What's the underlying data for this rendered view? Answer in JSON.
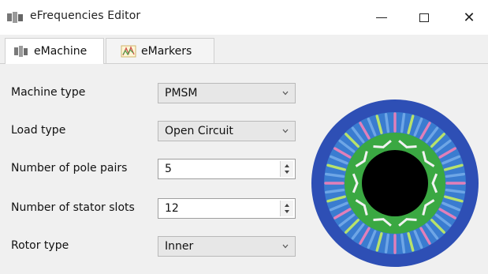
{
  "window": {
    "title": "eFrequencies Editor",
    "minimize_icon": "minimize-icon",
    "maximize_icon": "maximize-icon",
    "close_glyph": "✕"
  },
  "tabs": [
    {
      "label": "eMachine",
      "active": true,
      "icon": "machine-icon"
    },
    {
      "label": "eMarkers",
      "active": false,
      "icon": "markers-icon"
    }
  ],
  "form": {
    "machine_type": {
      "label": "Machine type",
      "value": "PMSM"
    },
    "load_type": {
      "label": "Load type",
      "value": "Open Circuit"
    },
    "pole_pairs": {
      "label": "Number of pole pairs",
      "value": "5"
    },
    "stator_slots": {
      "label": "Number of stator slots",
      "value": "12"
    },
    "rotor_type": {
      "label": "Rotor type",
      "value": "Inner"
    }
  },
  "colors": {
    "stator_outer": "#2e4fb5",
    "air_gap_ring": "#3a7cd0",
    "rotor_core": "#3aa842",
    "shaft": "#000000",
    "magnet_white": "#f2f2f2",
    "coil_pink": "#e17fb9",
    "coil_blue": "#6ea6e6",
    "coil_lime": "#b8e26a"
  }
}
